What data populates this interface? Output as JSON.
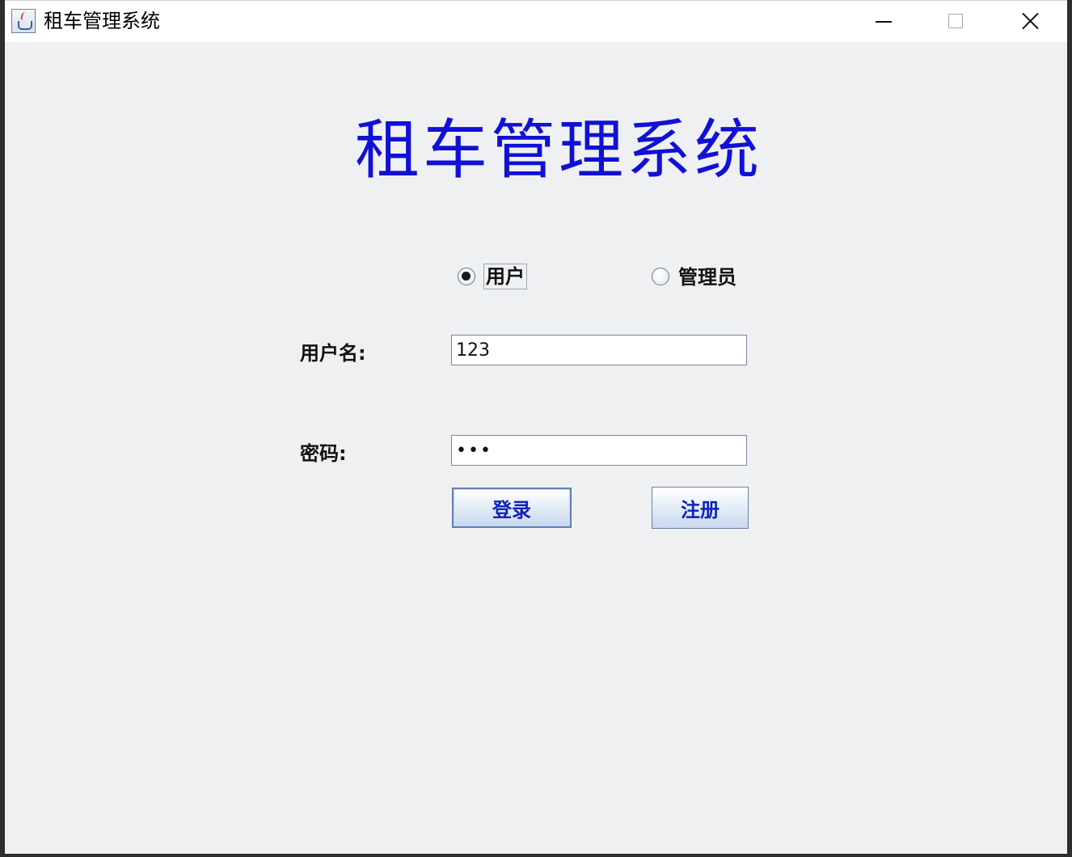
{
  "window": {
    "title": "租车管理系统",
    "controls": {
      "minimize": "minimize",
      "maximize": "maximize",
      "close": "close"
    }
  },
  "login": {
    "heading": "租车管理系统",
    "roles": [
      {
        "label": "用户",
        "selected": true
      },
      {
        "label": "管理员",
        "selected": false
      }
    ],
    "username_label": "用户名:",
    "username_value": "123",
    "password_label": "密码:",
    "password_value": "123",
    "login_button": "登录",
    "register_button": "注册"
  },
  "colors": {
    "heading": "#1010d6",
    "button_text": "#0f23b8",
    "background": "#eff0f2"
  }
}
